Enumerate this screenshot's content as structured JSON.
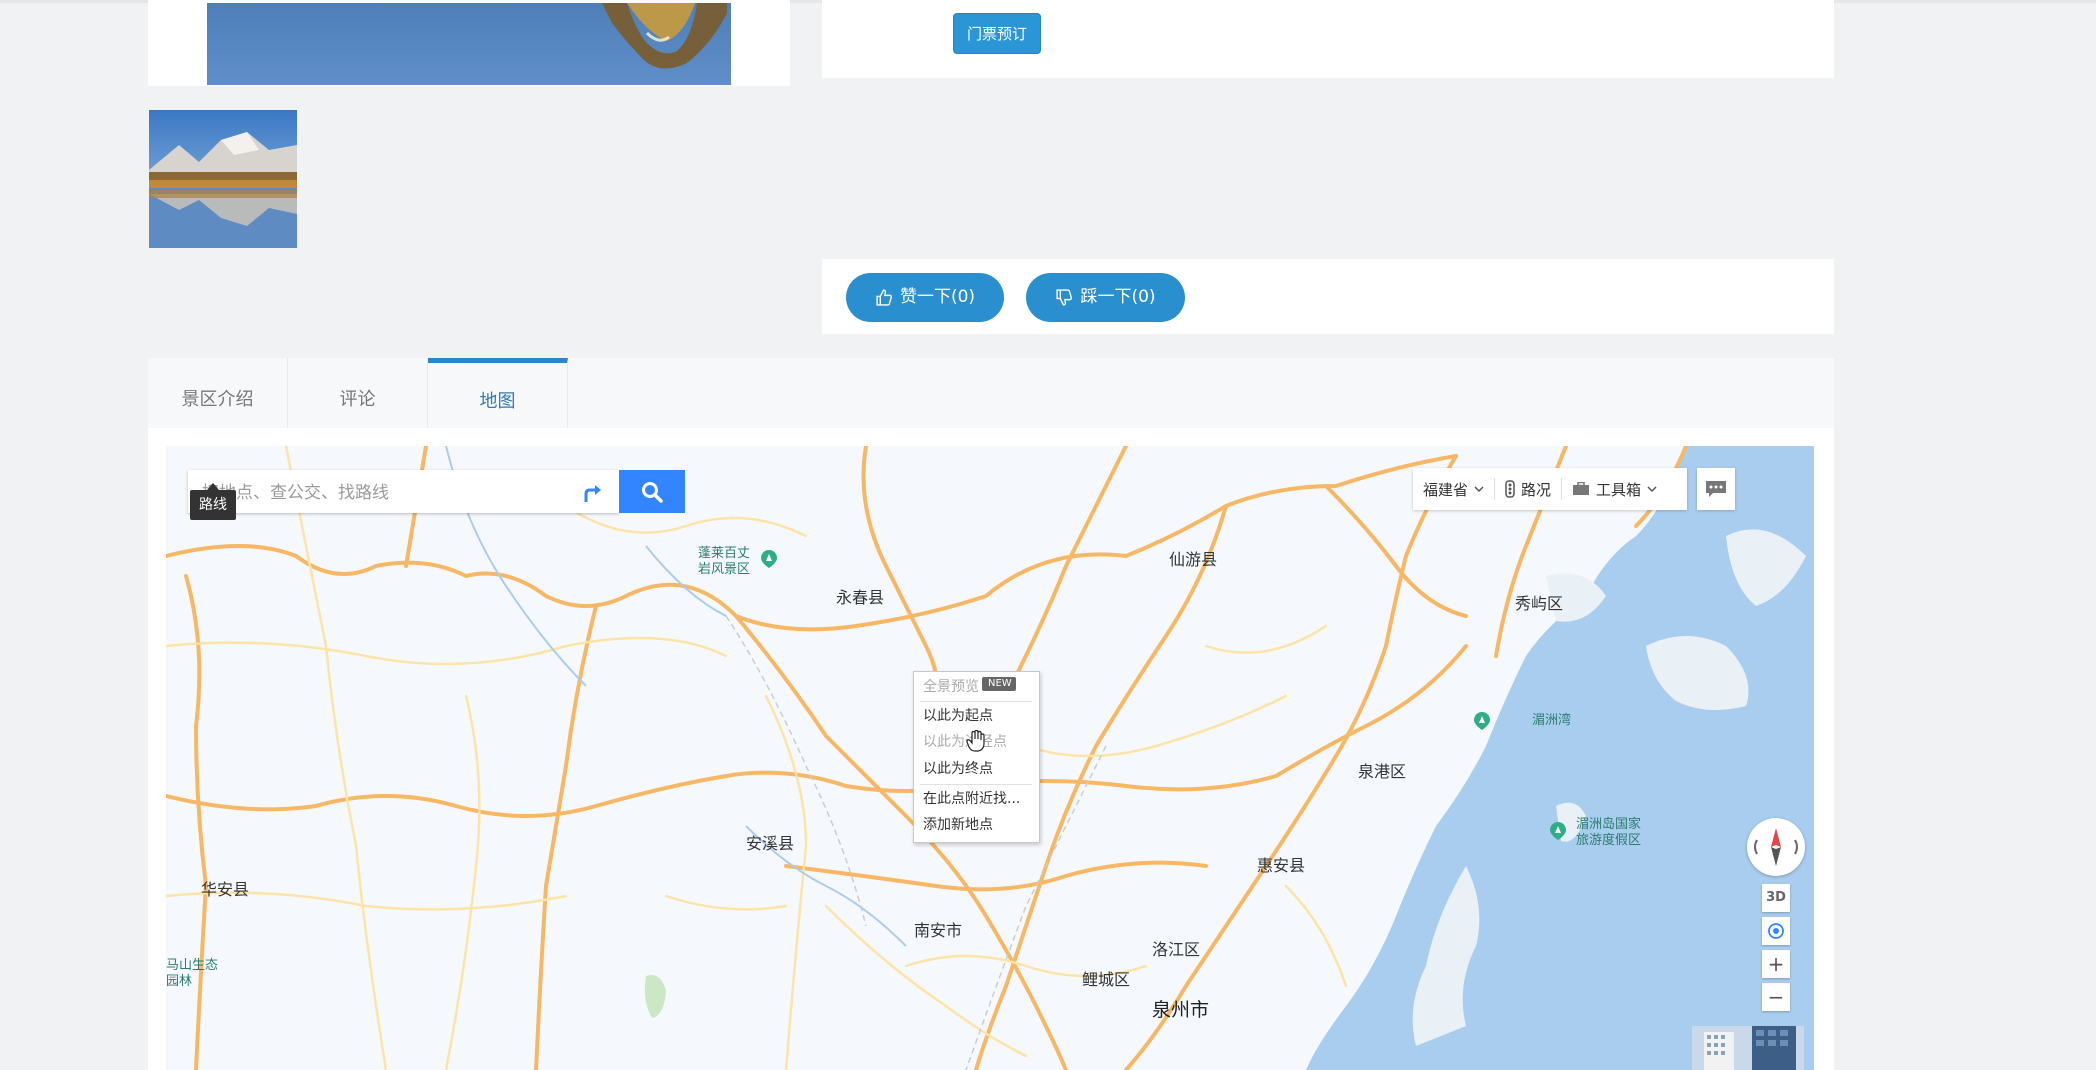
{
  "ticket": {
    "label": "门票预订"
  },
  "votes": {
    "like_label": "赞一下(0)",
    "dislike_label": "踩一下(0)"
  },
  "tabs": [
    {
      "label": "景区介绍"
    },
    {
      "label": "评论"
    },
    {
      "label": "地图"
    }
  ],
  "map": {
    "search_placeholder": "搜地点、查公交、找路线",
    "route_tooltip": "路线",
    "toolbar": {
      "province": "福建省",
      "traffic": "路况",
      "toolbox": "工具箱"
    },
    "controls": {
      "three_d": "3D",
      "zoom_in": "+",
      "zoom_out": "−"
    },
    "context_menu": {
      "panorama": "全景预览",
      "new_badge": "NEW",
      "set_start": "以此为起点",
      "set_waypoint": "以此为途经点",
      "set_end": "以此为终点",
      "search_nearby": "在此点附近找...",
      "add_place": "添加新地点"
    },
    "places": {
      "yongchun": "永春县",
      "xianyou": "仙游县",
      "xiuyu": "秀屿区",
      "quangang": "泉港区",
      "anxi": "安溪县",
      "huaan": "华安县",
      "huian": "惠安县",
      "nanan": "南安市",
      "luojiang": "洛江区",
      "licheng": "鲤城区",
      "quanzhou": "泉州市",
      "meizhouwan": "湄洲湾",
      "penglai_line1": "蓬莱百丈",
      "penglai_line2": "岩风景区",
      "meizhoudao_line1": "湄洲岛国家",
      "meizhoudao_line2": "旅游度假区",
      "shan_line1": "马山生态",
      "shan_line2": "园林"
    }
  }
}
